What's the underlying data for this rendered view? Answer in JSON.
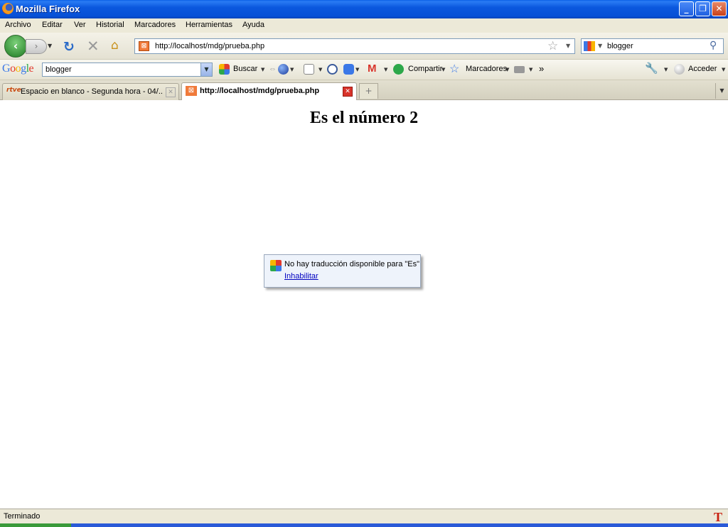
{
  "window": {
    "title": "Mozilla Firefox",
    "min": "_",
    "max": "❐",
    "close": "✕"
  },
  "menu": [
    "Archivo",
    "Editar",
    "Ver",
    "Historial",
    "Marcadores",
    "Herramientas",
    "Ayuda"
  ],
  "nav": {
    "url": "http://localhost/mdg/prueba.php",
    "search_value": "blogger"
  },
  "google_toolbar": {
    "logo": "Google",
    "query": "blogger",
    "search_label": "Buscar",
    "share_label": "Compartir",
    "bookmarks_label": "Marcadores",
    "more": "»",
    "signin_label": "Acceder"
  },
  "tabs": [
    {
      "label": "Espacio en blanco - Segunda hora - 04/...",
      "icon_text": "rtve",
      "active": false
    },
    {
      "label": "http://localhost/mdg/prueba.php",
      "icon_text": "⊠",
      "active": true
    }
  ],
  "page": {
    "heading": "Es el número 2",
    "popup_message": "No hay traducción disponible para \"Es\"",
    "popup_link": "Inhabilitar"
  },
  "status": {
    "text": "Terminado",
    "icon": "T"
  },
  "icons": {
    "back": "back-arrow-icon",
    "forward": "forward-arrow-icon",
    "reload": "reload-icon",
    "stop": "stop-icon",
    "home": "home-icon",
    "bookmark_star": "star-icon",
    "search": "magnifier-icon",
    "wrench": "wrench-icon"
  },
  "colors": {
    "titlebar": "#0b58de",
    "back_button": "#1e7a22",
    "close_tab": "#d8332a",
    "link": "#0000c0"
  }
}
